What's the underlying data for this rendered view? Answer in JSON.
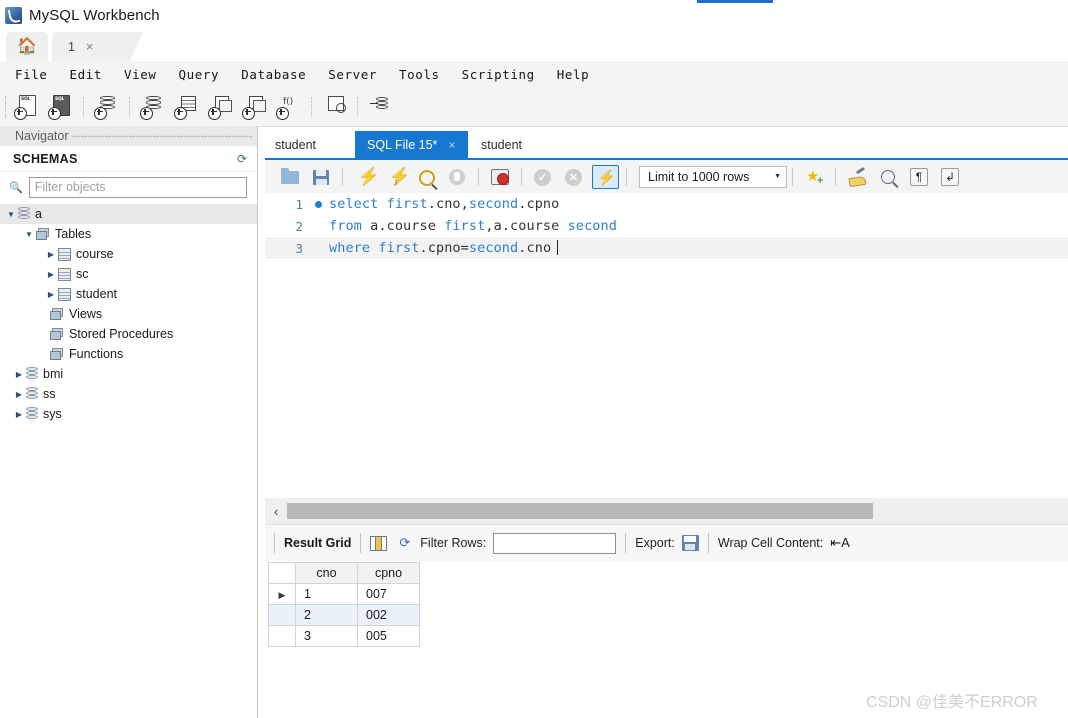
{
  "window": {
    "title": "MySQL Workbench",
    "app_icon": "mysql-dolphin-icon"
  },
  "tabstrip": {
    "home_icon": "home-icon",
    "connection_tab": {
      "label": "1",
      "close": "×"
    }
  },
  "menubar": {
    "items": [
      "File",
      "Edit",
      "View",
      "Query",
      "Database",
      "Server",
      "Tools",
      "Scripting",
      "Help"
    ]
  },
  "main_toolbar": {
    "icons": [
      "new-sql-tab-icon",
      "open-sql-script-icon",
      "server-status-icon",
      "new-schema-icon",
      "new-table-icon",
      "new-view-icon",
      "new-stored-procedure-icon",
      "new-function-icon",
      "search-table-data-icon",
      "reconnect-to-server-icon"
    ]
  },
  "sidebar": {
    "header": "Navigator",
    "section_title": "SCHEMAS",
    "refresh_icon": "refresh-icon",
    "search_icon": "search-icon",
    "filter": {
      "value": "",
      "placeholder": "Filter objects"
    },
    "tree": [
      {
        "label": "a",
        "icon": "database-icon",
        "twisty": "▼",
        "depth": 0,
        "selected": true
      },
      {
        "label": "Tables",
        "icon": "folder-icon",
        "twisty": "▼",
        "depth": 1,
        "selected": false
      },
      {
        "label": "course",
        "icon": "table-icon",
        "twisty": "▶",
        "depth": 2,
        "selected": false
      },
      {
        "label": "sc",
        "icon": "table-icon",
        "twisty": "▶",
        "depth": 2,
        "selected": false
      },
      {
        "label": "student",
        "icon": "table-icon",
        "twisty": "▶",
        "depth": 2,
        "selected": false
      },
      {
        "label": "Views",
        "icon": "folder-icon",
        "twisty": "",
        "depth": 1,
        "selected": false
      },
      {
        "label": "Stored Procedures",
        "icon": "folder-icon",
        "twisty": "",
        "depth": 1,
        "selected": false
      },
      {
        "label": "Functions",
        "icon": "folder-icon",
        "twisty": "",
        "depth": 1,
        "selected": false
      },
      {
        "label": "bmi",
        "icon": "database-icon",
        "twisty": "▶",
        "depth": 0,
        "selected": false
      },
      {
        "label": "ss",
        "icon": "database-icon",
        "twisty": "▶",
        "depth": 0,
        "selected": false
      },
      {
        "label": "sys",
        "icon": "database-icon",
        "twisty": "▶",
        "depth": 0,
        "selected": false
      }
    ]
  },
  "editor_tabs": [
    {
      "label": "student",
      "active": false,
      "closable": false
    },
    {
      "label": "SQL File 15*",
      "active": true,
      "closable": true,
      "close": "×"
    },
    {
      "label": "student",
      "active": false,
      "closable": false
    }
  ],
  "sql_toolbar": {
    "icons": [
      "open-file-icon",
      "save-file-icon",
      "execute-statement-icon",
      "execute-current-statement-icon",
      "explain-query-icon",
      "stop-script-icon",
      "toggle-stop-on-error-icon",
      "commit-icon",
      "rollback-icon",
      "toggle-autocommit-icon",
      "beautify-query-icon",
      "find-icon",
      "toggle-invisible-characters-icon",
      "toggle-word-wrap-icon"
    ],
    "limit_select": {
      "value": "Limit to 1000 rows",
      "caret": "▼"
    },
    "pilcrow_glyph": "¶",
    "wrap_glyph": "↲"
  },
  "code_editor": {
    "lines": [
      {
        "number": "1",
        "has_breakpoint_dot": true,
        "current": false,
        "tokens": [
          {
            "t": "select ",
            "k": "kw"
          },
          {
            "t": "first",
            "k": "kw"
          },
          {
            "t": ".cno,",
            "k": "id"
          },
          {
            "t": "second",
            "k": "kw"
          },
          {
            "t": ".cpno",
            "k": "id"
          }
        ]
      },
      {
        "number": "2",
        "has_breakpoint_dot": false,
        "current": false,
        "tokens": [
          {
            "t": "from ",
            "k": "kw"
          },
          {
            "t": "a.course ",
            "k": "id"
          },
          {
            "t": "first",
            "k": "kw"
          },
          {
            "t": ",a.course ",
            "k": "id"
          },
          {
            "t": "second",
            "k": "kw"
          }
        ]
      },
      {
        "number": "3",
        "has_breakpoint_dot": false,
        "current": true,
        "tokens": [
          {
            "t": "where ",
            "k": "kw"
          },
          {
            "t": "first",
            "k": "kw"
          },
          {
            "t": ".cpno=",
            "k": "id"
          },
          {
            "t": "second",
            "k": "kw"
          },
          {
            "t": ".cno",
            "k": "id"
          }
        ]
      }
    ],
    "keyword_color": "#2c7fc9",
    "identifier_color": "#333333",
    "gutter_color": "#4d7ea8",
    "current_line_bg": "#f2f2f2"
  },
  "hscroll": {
    "left_arrow": "‹"
  },
  "result_toolbar": {
    "result_grid_label": "Result Grid",
    "grid_view_icon": "grid-view-icon",
    "refresh_icon": "refresh-icon",
    "filter_rows_label": "Filter Rows:",
    "filter_rows_value": "",
    "export_label": "Export:",
    "export_icon": "export-recordset-icon",
    "wrap_cell_label": "Wrap Cell Content:",
    "wrap_cell_icon": "wrap-cell-content-icon"
  },
  "result_grid": {
    "columns": [
      "cno",
      "cpno"
    ],
    "rows": [
      {
        "n": "1",
        "cno": "1",
        "cpno": "007",
        "selected": false,
        "marker": "▶"
      },
      {
        "n": "2",
        "cno": "2",
        "cpno": "002",
        "selected": true,
        "marker": ""
      },
      {
        "n": "3",
        "cno": "3",
        "cpno": "005",
        "selected": false,
        "marker": ""
      }
    ],
    "selected_row_bg": "#eaf1fb"
  },
  "watermark": {
    "text": "CSDN @佳美不ERROR"
  },
  "colors": {
    "accent_blue": "#1878d0",
    "toolbar_bg": "#f4f4f4",
    "sidebar_border": "#c8c8c8"
  }
}
